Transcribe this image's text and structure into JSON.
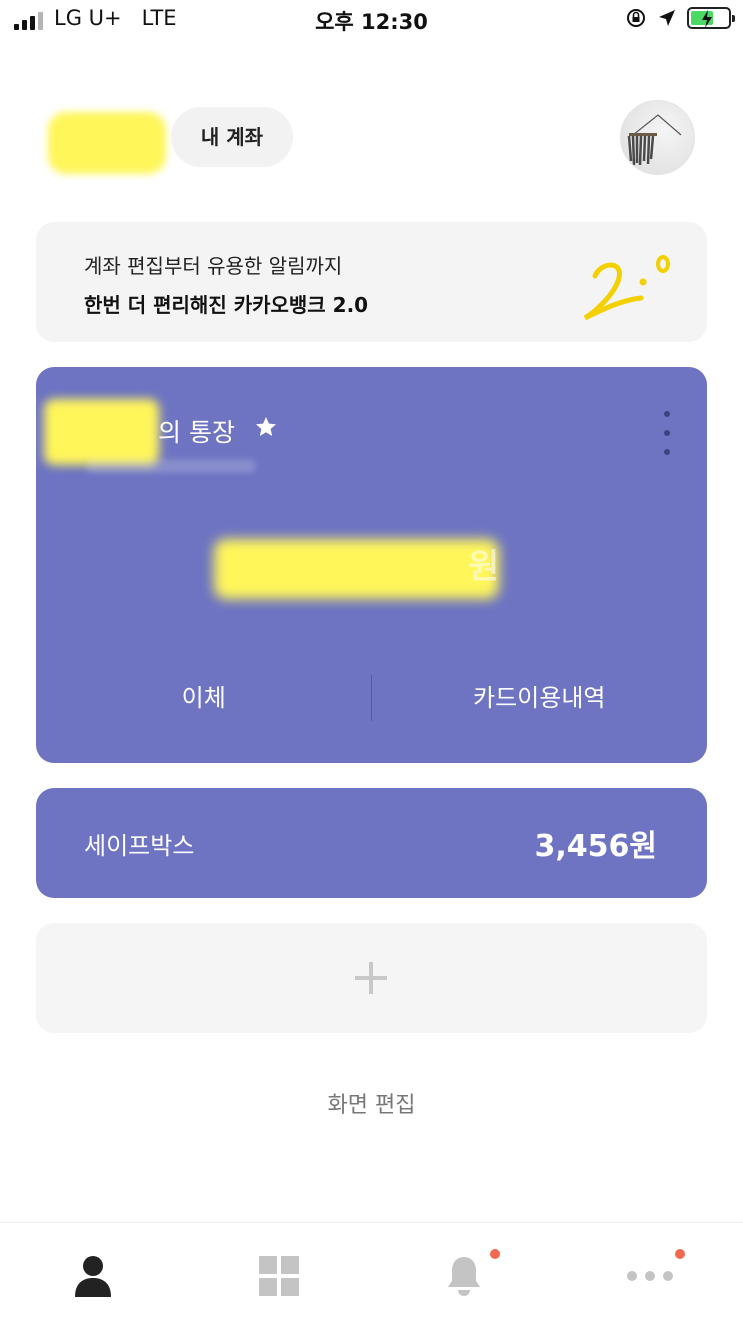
{
  "status_bar": {
    "carrier": "LG U+   LTE",
    "time": "오후 12:30"
  },
  "header": {
    "my_account_label": "내 계좌"
  },
  "banner": {
    "line1": "계좌 편집부터 유용한 알림까지",
    "line2": "한번 더 편리해진 카카오뱅크 2.0",
    "art_text": "2.0"
  },
  "account_card": {
    "name_suffix": "의 통장",
    "balance_unit": "원",
    "actions": [
      "이체",
      "카드이용내역"
    ],
    "color": "#6e74c2"
  },
  "safebox": {
    "label": "세이프박스",
    "amount": "3,456원"
  },
  "edit_label": "화면 편집",
  "tabs": [
    {
      "icon": "person-icon",
      "active": true,
      "badge": false
    },
    {
      "icon": "grid-icon",
      "active": false,
      "badge": false
    },
    {
      "icon": "bell-icon",
      "active": false,
      "badge": true
    },
    {
      "icon": "more-icon",
      "active": false,
      "badge": true
    }
  ],
  "colors": {
    "accent": "#6e74c2",
    "highlight": "#fff65a",
    "badge": "#f26a4f",
    "art": "#f5d000"
  }
}
